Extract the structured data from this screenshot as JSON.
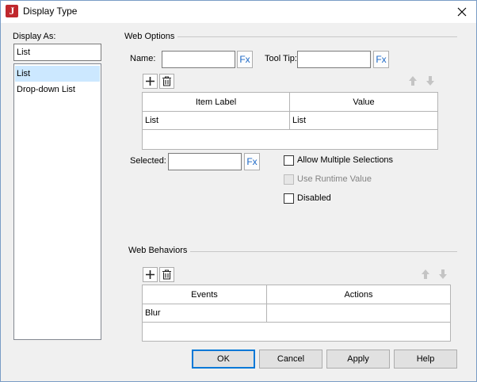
{
  "window": {
    "title": "Display Type",
    "app_icon_letter": "J"
  },
  "display_as": {
    "label": "Display As:",
    "value": "List",
    "items": [
      "List",
      "Drop-down List"
    ],
    "selected_index": 0
  },
  "web_options": {
    "title": "Web Options",
    "name_label": "Name:",
    "name_value": "",
    "tooltip_label": "Tool Tip:",
    "tooltip_value": "",
    "fx_label": "Fx",
    "columns": [
      "Item Label",
      "Value"
    ],
    "rows": [
      [
        "List",
        "List"
      ]
    ],
    "selected_label": "Selected:",
    "selected_value": "",
    "allow_multiple_label": "Allow Multiple Selections",
    "use_runtime_label": "Use Runtime Value",
    "disabled_label": "Disabled"
  },
  "web_behaviors": {
    "title": "Web Behaviors",
    "columns": [
      "Events",
      "Actions"
    ],
    "rows": [
      [
        "Blur",
        ""
      ]
    ]
  },
  "buttons": {
    "ok": "OK",
    "cancel": "Cancel",
    "apply": "Apply",
    "help": "Help"
  },
  "icons": {
    "add": "plus-icon",
    "delete": "trash-icon",
    "up": "arrow-up-icon",
    "down": "arrow-down-icon",
    "close": "close-icon",
    "app": "app-logo-icon"
  },
  "colors": {
    "selection": "#cce8ff",
    "accent": "#0078d7",
    "fx": "#1c68c6",
    "app_icon": "#c0282d"
  }
}
